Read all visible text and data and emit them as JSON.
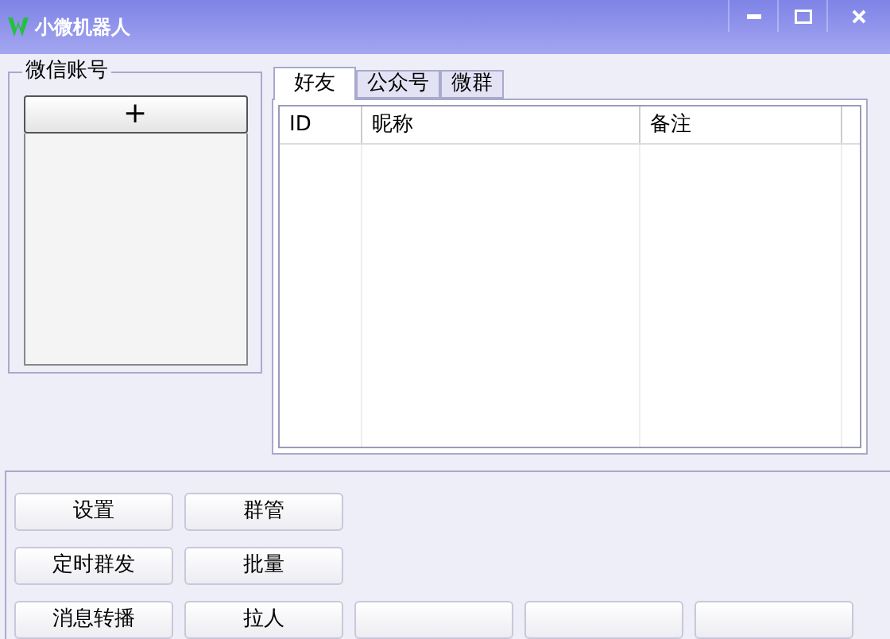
{
  "window": {
    "title": "小微机器人"
  },
  "account_group": {
    "title": "微信账号",
    "add_button": "+"
  },
  "tabs": [
    {
      "label": "好友",
      "selected": true
    },
    {
      "label": "公众号",
      "selected": false
    },
    {
      "label": "微群",
      "selected": false
    }
  ],
  "table": {
    "columns": [
      "ID",
      "昵称",
      "备注"
    ]
  },
  "buttons": [
    [
      {
        "kind": "text",
        "label": "设置"
      },
      {
        "kind": "text",
        "label": "群管"
      }
    ],
    [
      {
        "kind": "text",
        "label": "定时群发"
      },
      {
        "kind": "text",
        "label": "批量"
      }
    ],
    [
      {
        "kind": "text",
        "label": "消息转播"
      },
      {
        "kind": "text",
        "label": "拉人"
      },
      {
        "kind": "blank"
      },
      {
        "kind": "blank"
      },
      {
        "kind": "blank"
      }
    ]
  ]
}
